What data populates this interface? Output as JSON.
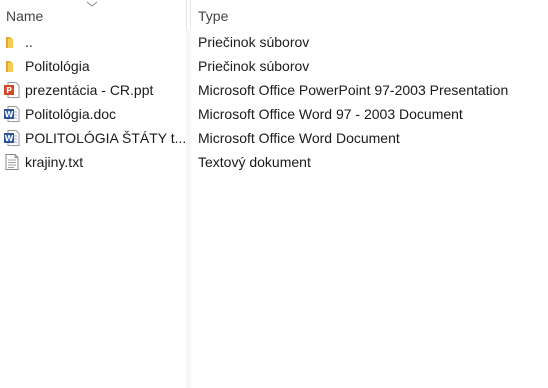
{
  "header": {
    "name_label": "Name",
    "type_label": "Type"
  },
  "files": [
    {
      "name": "..",
      "type": "Priečinok súborov",
      "icon": "folder-icon"
    },
    {
      "name": "Politológia",
      "type": "Priečinok súborov",
      "icon": "folder-icon"
    },
    {
      "name": "prezentácia - CR.ppt",
      "type": "Microsoft Office PowerPoint 97-2003 Presentation",
      "icon": "powerpoint-file-icon"
    },
    {
      "name": "Politológia.doc",
      "type": "Microsoft Office Word 97 - 2003 Document",
      "icon": "word-file-icon"
    },
    {
      "name": "POLITOLÓGIA ŠTÁTY t...",
      "type": "Microsoft Office Word Document",
      "icon": "word-file-icon"
    },
    {
      "name": "krajiny.txt",
      "type": "Textový dokument",
      "icon": "text-file-icon"
    }
  ],
  "colors": {
    "folder": "#f3c44a",
    "powerpoint": "#d24726",
    "word": "#2b5797"
  }
}
